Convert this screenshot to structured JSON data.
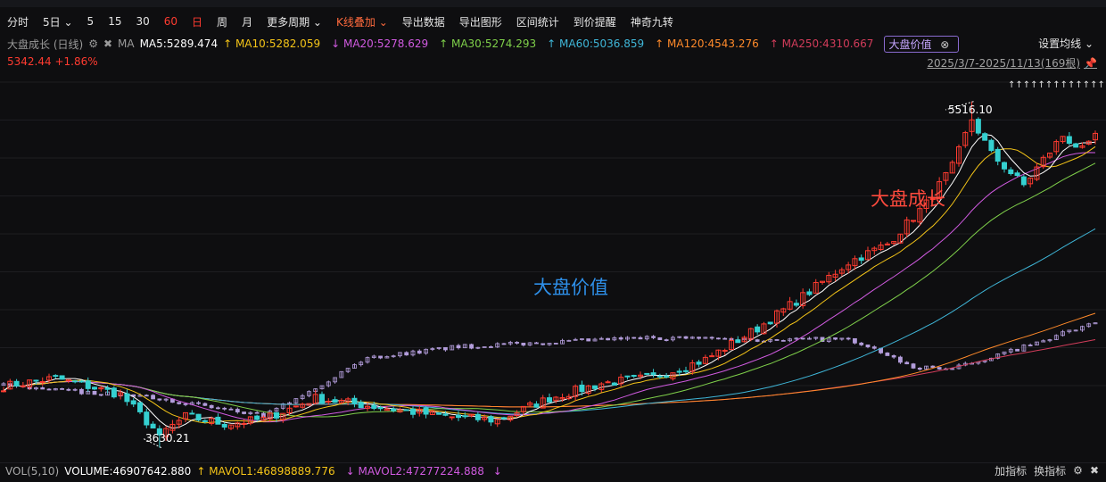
{
  "toolbar": {
    "items": [
      "分时",
      "5日",
      "5",
      "15",
      "30",
      "60",
      "日",
      "周",
      "月",
      "更多周期",
      "K线叠加",
      "导出数据",
      "导出图形",
      "区间统计",
      "到价提醒",
      "神奇九转"
    ]
  },
  "ma_row": {
    "title": "大盘成长 (日线)",
    "ma_label": "MA",
    "ma5": "MA5:5289.474",
    "ma10": "MA10:5282.059",
    "ma20": "MA20:5278.629",
    "ma30": "MA30:5274.293",
    "ma60": "MA60:5036.859",
    "ma120": "MA120:4543.276",
    "ma250": "MA250:4310.667",
    "overlay_tag": "大盘价值",
    "settings": "设置均线"
  },
  "price": {
    "last": "5342.44",
    "change": "+1.86%"
  },
  "range": {
    "text": "2025/3/7-2025/11/13(169根)"
  },
  "chart_data": {
    "type": "candlestick",
    "high_label": "5516.10",
    "low_label": "3630.21",
    "series_labels": {
      "main": "大盘成长",
      "overlay": "大盘价值"
    },
    "colors": {
      "up": "#ff3b30",
      "down": "#35d0d0",
      "ma5": "#ffffff",
      "ma10": "#f5c518",
      "ma20": "#d05ae0",
      "ma30": "#7fd04a",
      "ma60": "#3fb6d8",
      "ma120": "#ff8a2a",
      "ma250": "#d23c5a",
      "overlay": "#b39ddb",
      "main_label": "#ff4a3d",
      "overlay_label": "#2e8fe8"
    },
    "markers": "↑↑↑↑↑↑↑↑↑↑↑↑↑↑"
  },
  "volume_row": {
    "label": "VOL(5,10)",
    "volume": "VOLUME:46907642.880",
    "mavol1": "MAVOL1:46898889.776",
    "mavol2": "MAVOL2:47277224.888",
    "add_indicator": "加指标",
    "change_indicator": "换指标"
  }
}
